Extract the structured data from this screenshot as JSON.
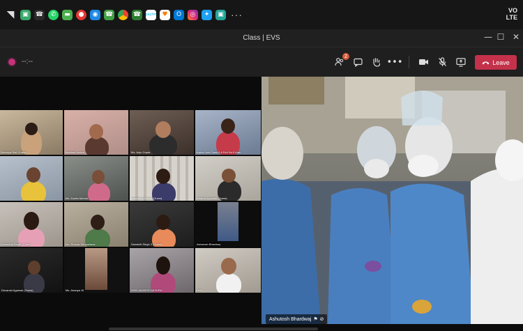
{
  "status_bar": {
    "apps": [
      "app-green",
      "phone",
      "whatsapp",
      "messages",
      "red-app",
      "blue-app",
      "phone2",
      "chrome",
      "phone3",
      "paytm",
      "heart-app",
      "outlook",
      "instagram",
      "twitter",
      "green-app"
    ],
    "more": "···",
    "network_line1": "VO",
    "network_line2": "LTE"
  },
  "window": {
    "title": "Class | EVS",
    "minimize": "—",
    "maximize": "☐",
    "close": "✕"
  },
  "toolbar": {
    "timer": "--:--",
    "participants_badge": "2",
    "leave_label": "Leave"
  },
  "gallery": {
    "participants": [
      "Mauriya Rail (Guest)",
      "Madhav Mehra",
      "Ms. Anju Gupta",
      "Arpita Jain Class 5 A Roll No.5 Alan...",
      "",
      "",
      "Ms. Kavita Mohan",
      "Atharva Agarwal (Guest)",
      "Ms. R",
      "Ms. Kavita Sinha",
      "Akanksha Mehta (Guest)",
      "",
      "Aashritha Singh (Guest)",
      "Ms. Shama Shrivastava",
      "Sanskriti Singh 3 (Guest)",
      "Ashutosh Bhardwaj",
      "Devansh Agarwal (Guest)",
      "Ms. Ananya Jil",
      "SHRI MAHESH MISHRA",
      "Hriti"
    ]
  },
  "main_video": {
    "name": "Ashutosh Bhardwaj"
  }
}
